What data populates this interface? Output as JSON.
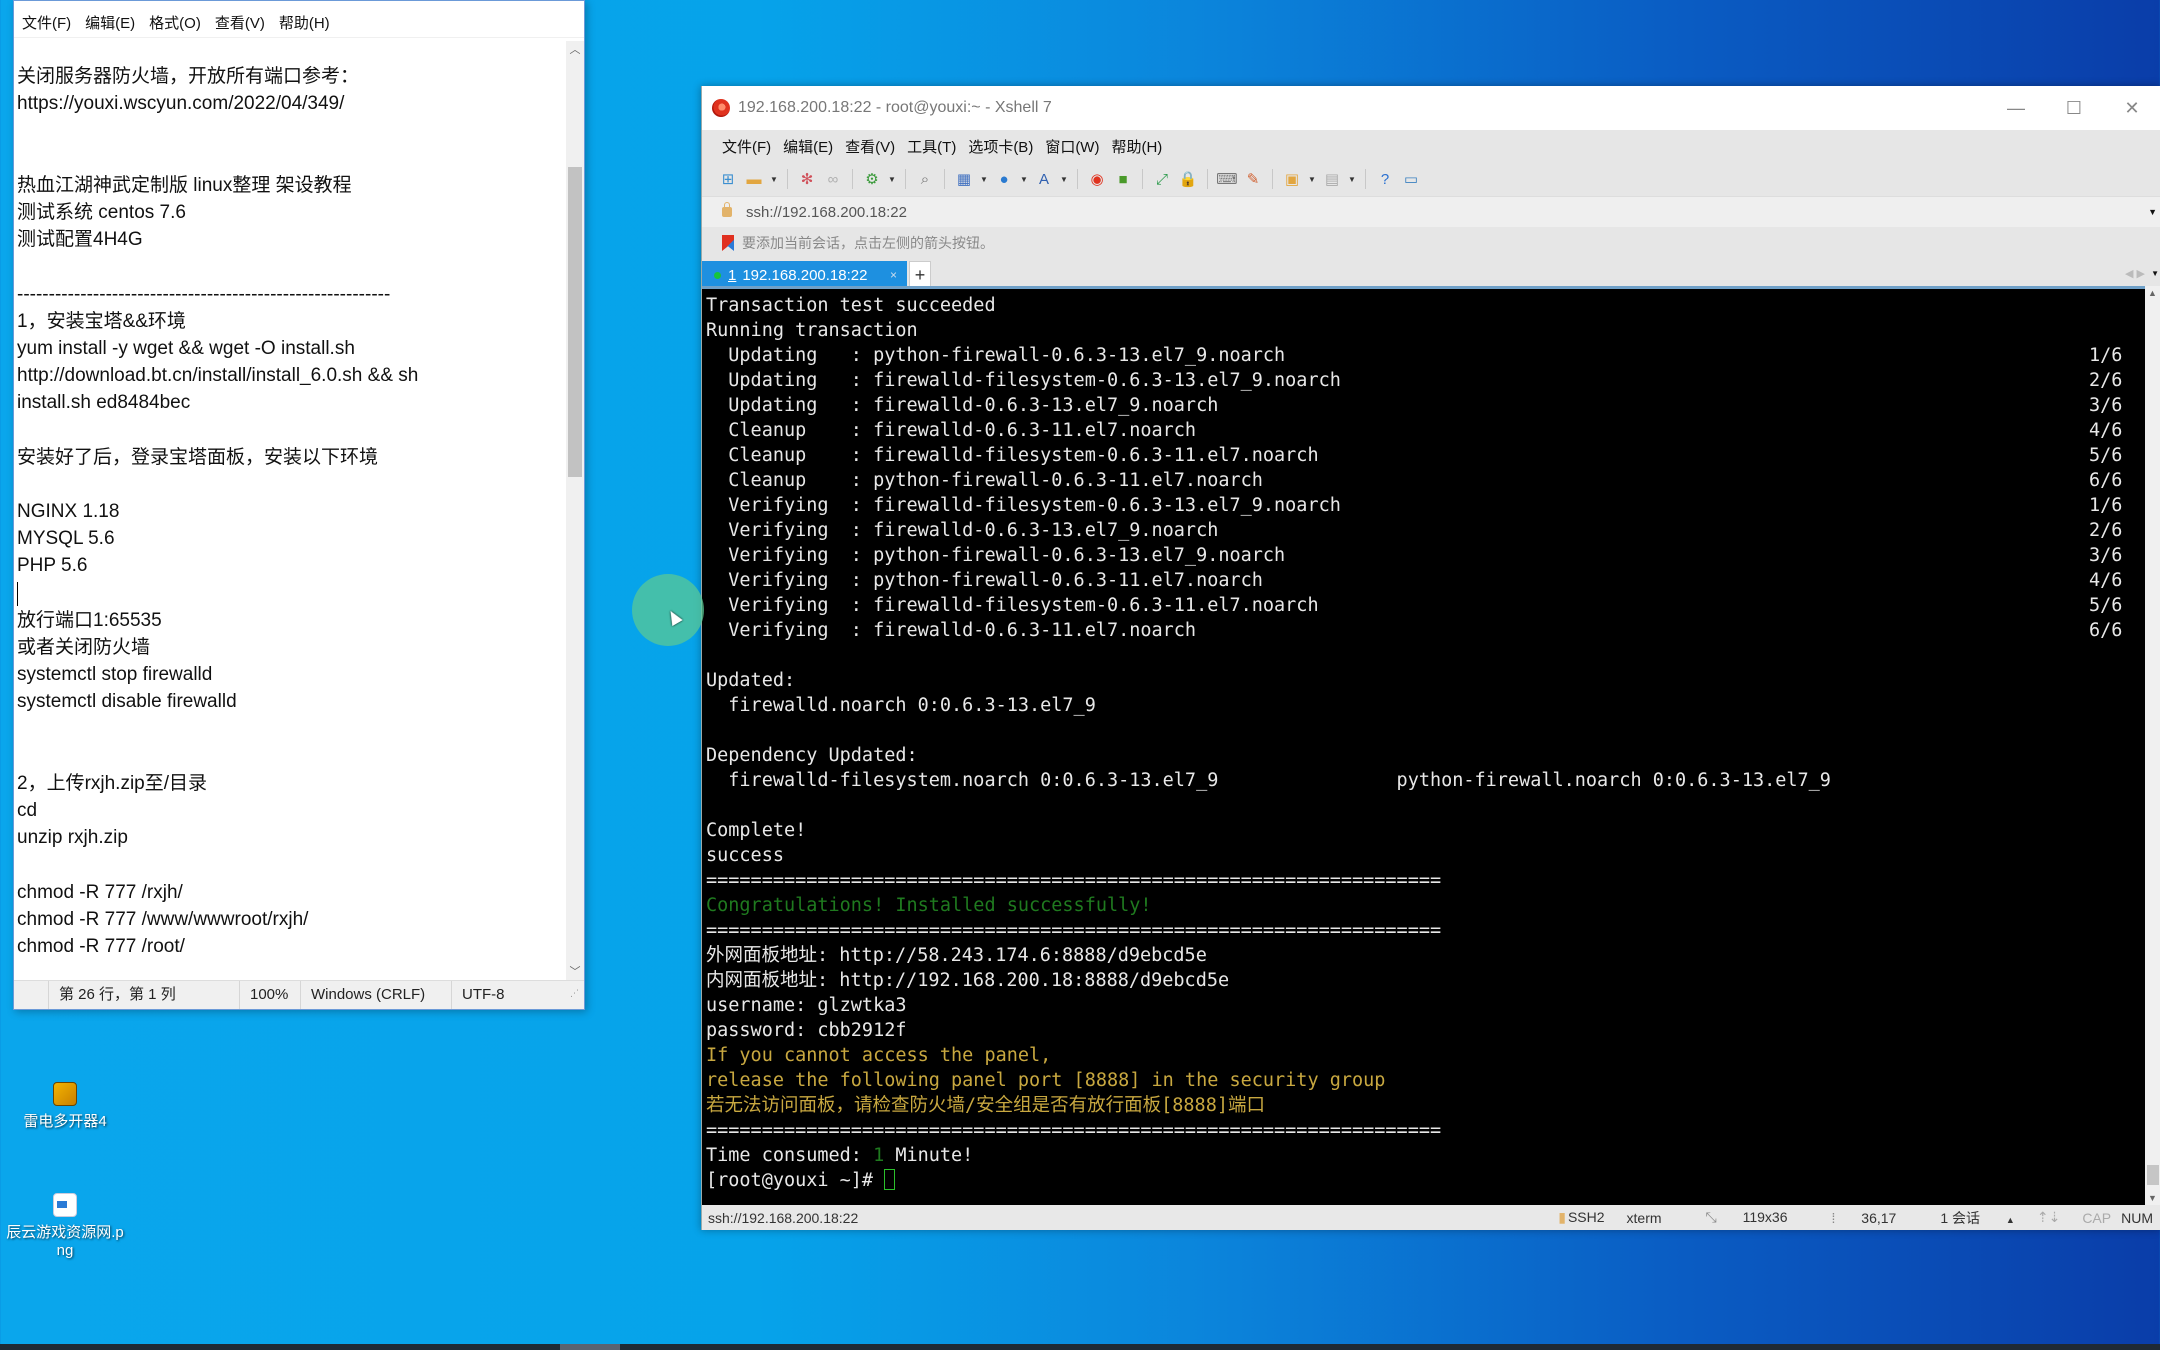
{
  "desktop": {
    "icons": [
      {
        "label": "雷电多开器4",
        "icon": "ldplayer-multi-icon"
      },
      {
        "label": "辰云游戏资源网.png",
        "icon": "png-file-icon"
      }
    ]
  },
  "notepad": {
    "menu": [
      "文件(F)",
      "编辑(E)",
      "格式(O)",
      "查看(V)",
      "帮助(H)"
    ],
    "lines": [
      "关闭服务器防火墙，开放所有端口参考：",
      "https://youxi.wscyun.com/2022/04/349/",
      "",
      "",
      "热血江湖神武定制版 linux整理 架设教程",
      "测试系统 centos 7.6",
      "测试配置4H4G",
      "",
      "-----------------------------------------------------------",
      "1，安装宝塔&&环境",
      "yum install -y wget && wget -O install.sh",
      "http://download.bt.cn/install/install_6.0.sh && sh",
      "install.sh ed8484bec",
      "",
      "安装好了后，登录宝塔面板，安装以下环境",
      "",
      "NGINX 1.18",
      "MYSQL 5.6",
      "PHP 5.6",
      "",
      "放行端口1:65535",
      "或者关闭防火墙",
      "systemctl stop firewalld",
      "systemctl disable firewalld",
      "",
      "",
      "2，上传rxjh.zip至/目录",
      "cd",
      "unzip rxjh.zip",
      "",
      "chmod -R 777 /rxjh/",
      "chmod -R 777 /www/wwwroot/rxjh/",
      "chmod -R 777 /root/"
    ],
    "caret_line_index": 19,
    "status": {
      "position": "第 26 行，第 1 列",
      "zoom": "100%",
      "line_ending": "Windows (CRLF)",
      "encoding": "UTF-8"
    }
  },
  "xshell": {
    "title": "192.168.200.18:22 - root@youxi:~ - Xshell 7",
    "window_controls": {
      "minimize": "—",
      "maximize": "☐",
      "close": "✕"
    },
    "menu": [
      "文件(F)",
      "编辑(E)",
      "查看(V)",
      "工具(T)",
      "选项卡(B)",
      "窗口(W)",
      "帮助(H)"
    ],
    "toolbar": [
      {
        "name": "new-session-icon",
        "glyph": "⊞",
        "color": "#3b8fd0",
        "dropdown": false
      },
      {
        "name": "open-folder-icon",
        "glyph": "▬",
        "color": "#e2a640",
        "dropdown": true
      },
      {
        "sep": true
      },
      {
        "name": "connect-icon",
        "glyph": "✻",
        "color": "#d0505a",
        "dropdown": false
      },
      {
        "name": "disconnect-icon",
        "glyph": "∞",
        "color": "#b0b0b0",
        "dropdown": false
      },
      {
        "sep": true
      },
      {
        "name": "session-properties-icon",
        "glyph": "⚙",
        "color": "#3a9a3a",
        "dropdown": true
      },
      {
        "sep": true
      },
      {
        "name": "find-icon",
        "glyph": "⌕",
        "color": "#777",
        "dropdown": false
      },
      {
        "sep": true
      },
      {
        "name": "transfer-icon",
        "glyph": "▦",
        "color": "#4070c0",
        "dropdown": true
      },
      {
        "name": "globe-icon",
        "glyph": "●",
        "color": "#2a7ad0",
        "dropdown": true
      },
      {
        "name": "font-icon",
        "glyph": "A",
        "color": "#3060b0",
        "dropdown": true
      },
      {
        "sep": true
      },
      {
        "name": "xshell-logo-icon",
        "glyph": "◉",
        "color": "#e0321e",
        "dropdown": false
      },
      {
        "name": "xftp-icon",
        "glyph": "■",
        "color": "#4a9a2a",
        "dropdown": false
      },
      {
        "sep": true
      },
      {
        "name": "fullscreen-icon",
        "glyph": "⤢",
        "color": "#2a9a4a",
        "dropdown": false
      },
      {
        "name": "lock-icon",
        "glyph": "🔒",
        "color": "#c8a070",
        "dropdown": false
      },
      {
        "sep": true
      },
      {
        "name": "keyboard-icon",
        "glyph": "⌨",
        "color": "#777",
        "dropdown": false
      },
      {
        "name": "highlight-icon",
        "glyph": "✎",
        "color": "#d06030",
        "dropdown": false
      },
      {
        "sep": true
      },
      {
        "name": "add-folder-icon",
        "glyph": "▣",
        "color": "#e2a640",
        "dropdown": true
      },
      {
        "name": "layout-icon",
        "glyph": "▤",
        "color": "#aaa",
        "dropdown": true
      },
      {
        "sep": true
      },
      {
        "name": "help-icon",
        "glyph": "?",
        "color": "#2a70d0",
        "dropdown": false
      },
      {
        "name": "chat-icon",
        "glyph": "▭",
        "color": "#3a80c0",
        "dropdown": false
      }
    ],
    "address": "ssh://192.168.200.18:22",
    "hint": "要添加当前会话，点击左侧的箭头按钮。",
    "tab": {
      "number": "1",
      "label": "192.168.200.18:22",
      "close": "×",
      "new_tab": "+"
    },
    "terminal": [
      {
        "text": "Transaction test succeeded"
      },
      {
        "text": "Running transaction"
      },
      {
        "text": "  Updating   : python-firewall-0.6.3-13.el7_9.noarch",
        "count": "1/6"
      },
      {
        "text": "  Updating   : firewalld-filesystem-0.6.3-13.el7_9.noarch",
        "count": "2/6"
      },
      {
        "text": "  Updating   : firewalld-0.6.3-13.el7_9.noarch",
        "count": "3/6"
      },
      {
        "text": "  Cleanup    : firewalld-0.6.3-11.el7.noarch",
        "count": "4/6"
      },
      {
        "text": "  Cleanup    : firewalld-filesystem-0.6.3-11.el7.noarch",
        "count": "5/6"
      },
      {
        "text": "  Cleanup    : python-firewall-0.6.3-11.el7.noarch",
        "count": "6/6"
      },
      {
        "text": "  Verifying  : firewalld-filesystem-0.6.3-13.el7_9.noarch",
        "count": "1/6"
      },
      {
        "text": "  Verifying  : firewalld-0.6.3-13.el7_9.noarch",
        "count": "2/6"
      },
      {
        "text": "  Verifying  : python-firewall-0.6.3-13.el7_9.noarch",
        "count": "3/6"
      },
      {
        "text": "  Verifying  : python-firewall-0.6.3-11.el7.noarch",
        "count": "4/6"
      },
      {
        "text": "  Verifying  : firewalld-filesystem-0.6.3-11.el7.noarch",
        "count": "5/6"
      },
      {
        "text": "  Verifying  : firewalld-0.6.3-11.el7.noarch",
        "count": "6/6"
      },
      {
        "text": ""
      },
      {
        "text": "Updated:"
      },
      {
        "text": "  firewalld.noarch 0:0.6.3-13.el7_9"
      },
      {
        "text": ""
      },
      {
        "text": "Dependency Updated:"
      },
      {
        "text": "  firewalld-filesystem.noarch 0:0.6.3-13.el7_9                python-firewall.noarch 0:0.6.3-13.el7_9"
      },
      {
        "text": ""
      },
      {
        "text": "Complete!"
      },
      {
        "text": "success"
      },
      {
        "text": "=================================================================="
      },
      {
        "text": "Congratulations! Installed successfully!",
        "color": "green"
      },
      {
        "text": "=================================================================="
      },
      {
        "text": "外网面板地址: http://58.243.174.6:8888/d9ebcd5e"
      },
      {
        "text": "内网面板地址: http://192.168.200.18:8888/d9ebcd5e"
      },
      {
        "text": "username: glzwtka3"
      },
      {
        "text": "password: cbb2912f"
      },
      {
        "text": "If you cannot access the panel,",
        "color": "yellow"
      },
      {
        "text": "release the following panel port [8888] in the security group",
        "color": "yellow"
      },
      {
        "text": "若无法访问面板，请检查防火墙/安全组是否有放行面板[8888]端口",
        "color": "yellow"
      },
      {
        "text": "=================================================================="
      },
      {
        "text": "Time consumed: ",
        "suffix_green": "1",
        "suffix": " Minute!"
      },
      {
        "text": "[root@youxi ~]# ",
        "cursor": true
      }
    ],
    "status": {
      "address": "ssh://192.168.200.18:22",
      "protocol": "SSH2",
      "terminal_type": "xterm",
      "size": "119x36",
      "cursor_pos": "36,17",
      "sessions": "1 会话",
      "cap": "CAP",
      "num": "NUM"
    }
  }
}
